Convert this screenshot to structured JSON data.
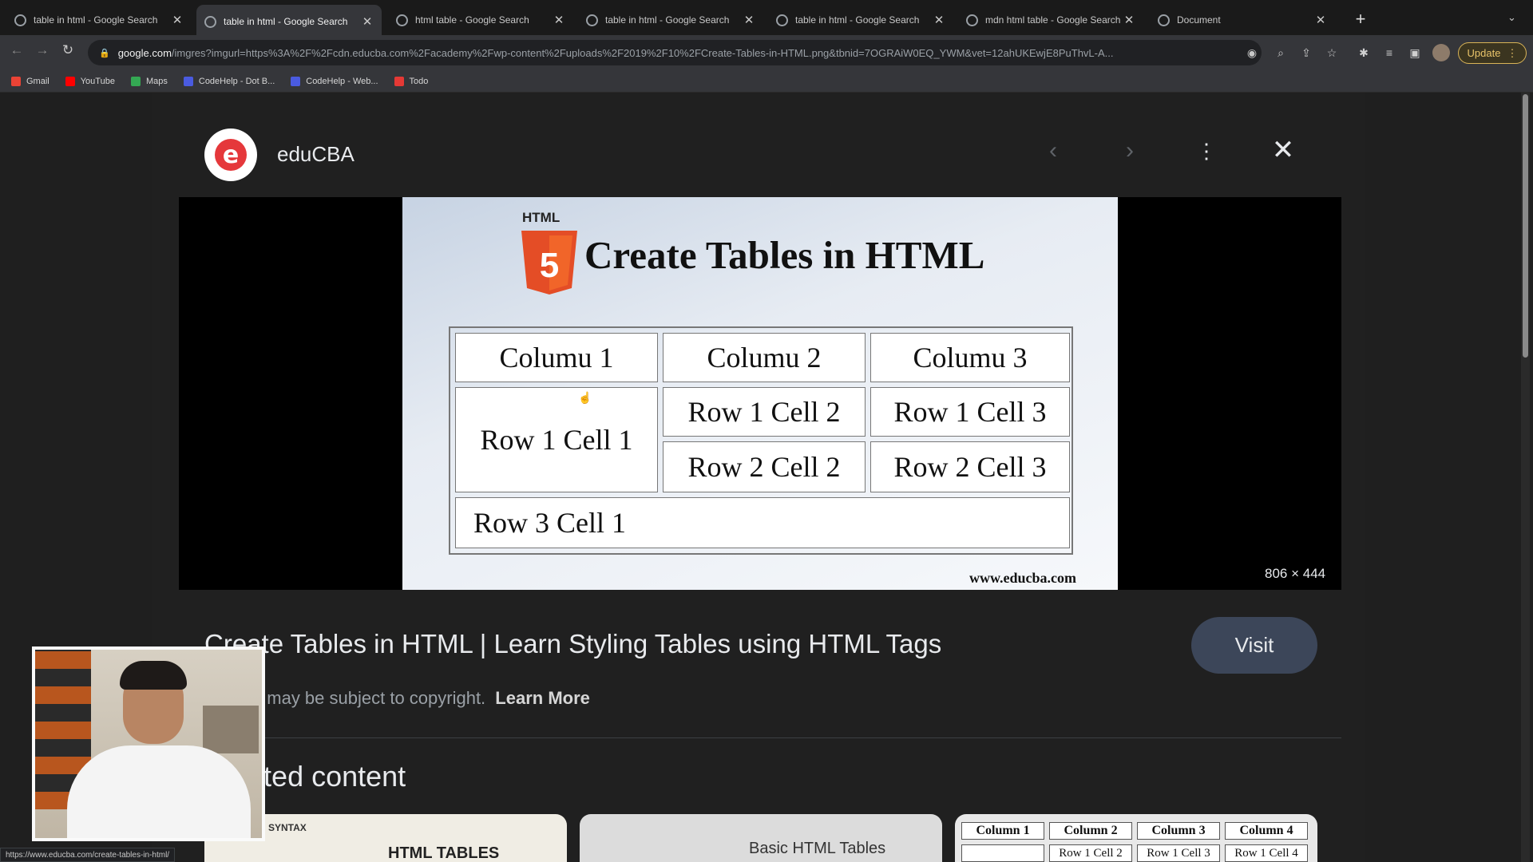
{
  "browser": {
    "tabs": [
      {
        "title": "table in html - Google Search"
      },
      {
        "title": "table in html - Google Search"
      },
      {
        "title": "html table - Google Search"
      },
      {
        "title": "table in html - Google Search"
      },
      {
        "title": "table in html - Google Search"
      },
      {
        "title": "mdn html table - Google Search"
      },
      {
        "title": "Document"
      }
    ],
    "active_tab_index": 1,
    "url": {
      "domain": "google.com",
      "path": "/imgres?imgurl=https%3A%2F%2Fcdn.educba.com%2Facademy%2Fwp-content%2Fuploads%2F2019%2F10%2FCreate-Tables-in-HTML.png&tbnid=7OGRAiW0EQ_YWM&vet=12ahUKEwjE8PuThvL-A..."
    },
    "update_label": "Update",
    "bookmarks": [
      {
        "label": "Gmail",
        "color": "#ea4335"
      },
      {
        "label": "YouTube",
        "color": "#ff0000"
      },
      {
        "label": "Maps",
        "color": "#34a853"
      },
      {
        "label": "CodeHelp - Dot B...",
        "color": "#4a5be0"
      },
      {
        "label": "CodeHelp - Web...",
        "color": "#4a5be0"
      },
      {
        "label": "Todo",
        "color": "#e53935"
      }
    ]
  },
  "viewer": {
    "source_name": "eduCBA",
    "image_dimensions": "806 × 444",
    "result_title": "Create Tables in HTML | Learn Styling Tables using HTML Tags",
    "visit_label": "Visit",
    "copyright_text": "Images may be subject to copyright.",
    "learn_more": "Learn More",
    "related_heading": "Related content"
  },
  "preview_image": {
    "html_label": "HTML",
    "shield_text": "5",
    "title": "Create Tables in HTML",
    "cells": {
      "c1": "Columu 1",
      "c2": "Columu 2",
      "c3": "Columu 3",
      "r1c1": "Row 1 Cell 1",
      "r1c2": "Row 1 Cell 2",
      "r1c3": "Row 1 Cell 3",
      "r2c2": "Row 2 Cell 2",
      "r2c3": "Row 2 Cell 3",
      "r3c1": "Row 3 Cell 1"
    },
    "site": "www.educba.com"
  },
  "related_cards": {
    "card1": {
      "label": "SYNTAX",
      "title": "HTML TABLES"
    },
    "card2": {
      "title": "Basic HTML Tables"
    },
    "card3": {
      "headers": [
        "Column 1",
        "Column 2",
        "Column 3",
        "Column 4"
      ],
      "cells": [
        "Row 1 Cell 2",
        "Row 1 Cell 3",
        "Row 1 Cell 4"
      ]
    }
  },
  "status_bar_url": "https://www.educba.com/create-tables-in-html/",
  "colors": {
    "accent_brand": "#e5383b",
    "visit_button": "#3c4659",
    "update_border": "#d9b457",
    "html5_orange": "#e44d26"
  }
}
